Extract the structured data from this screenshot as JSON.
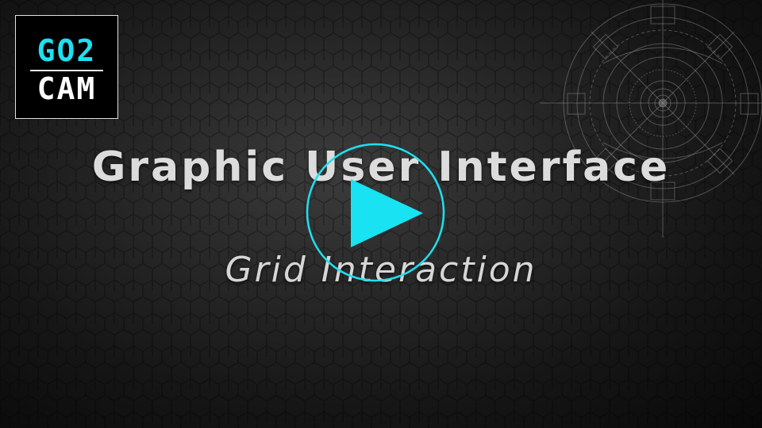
{
  "logo": {
    "line1": "GO2",
    "line2": "CAM"
  },
  "title": "Graphic User Interface",
  "subtitle": "Grid Interaction",
  "play_button": {
    "icon": "play-icon"
  },
  "colors": {
    "accent": "#1EE0F0",
    "title_text": "#DCDCDC",
    "background": "#1A1A1A"
  }
}
